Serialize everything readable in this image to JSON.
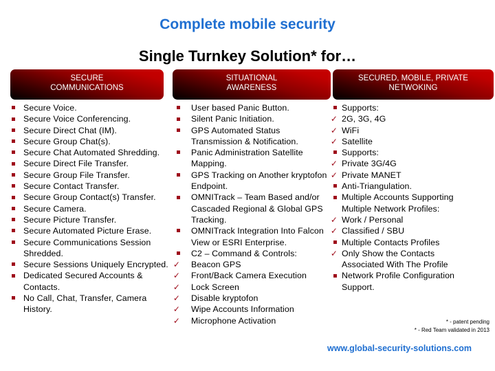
{
  "title": "Complete mobile security",
  "subtitle": "Single Turnkey Solution* for…",
  "colors": {
    "title_blue": "#1f6fd1",
    "header_red": "#c00000",
    "bullet_red": "#9e0b1a"
  },
  "columns": [
    {
      "header": "SECURE\nCOMMUNICATIONS",
      "items": [
        {
          "marker": "square",
          "text": "Secure Voice."
        },
        {
          "marker": "square",
          "text": "Secure Voice Conferencing."
        },
        {
          "marker": "square",
          "text": "Secure Direct Chat (IM)."
        },
        {
          "marker": "square",
          "text": "Secure Group Chat(s)."
        },
        {
          "marker": "square",
          "text": "Secure Chat Automated Shredding."
        },
        {
          "marker": "square",
          "text": "Secure Direct File Transfer."
        },
        {
          "marker": "square",
          "text": "Secure Group File Transfer."
        },
        {
          "marker": "square",
          "text": "Secure Contact Transfer."
        },
        {
          "marker": "square",
          "text": "Secure Group Contact(s) Transfer."
        },
        {
          "marker": "square",
          "text": "Secure Camera."
        },
        {
          "marker": "square",
          "text": "Secure Picture Transfer."
        },
        {
          "marker": "square",
          "text": "Secure Automated Picture Erase."
        },
        {
          "marker": "square",
          "text": "Secure Communications Session Shredded."
        },
        {
          "marker": "square",
          "text": "Secure Sessions Uniquely Encrypted."
        },
        {
          "marker": "square",
          "text": "Dedicated Secured Accounts & Contacts."
        },
        {
          "marker": "square",
          "text": "No Call, Chat, Transfer, Camera History."
        }
      ]
    },
    {
      "header": "SITUATIONAL\nAWARENESS",
      "items": [
        {
          "marker": "square",
          "text": "User based Panic Button."
        },
        {
          "marker": "square",
          "text": "Silent Panic Initiation."
        },
        {
          "marker": "square",
          "text": "GPS Automated Status Transmission & Notification."
        },
        {
          "marker": "square",
          "text": "Panic Administration Satellite Mapping."
        },
        {
          "marker": "square",
          "text": "GPS Tracking on Another kryptofon Endpoint."
        },
        {
          "marker": "square",
          "text": "OMNITrack – Team Based and/or Cascaded Regional & Global GPS Tracking."
        },
        {
          "marker": "square",
          "text": "OMNITrack Integration Into Falcon View or ESRI Enterprise."
        },
        {
          "marker": "square",
          "text": "C2 – Command & Controls:"
        },
        {
          "marker": "check",
          "text": "Beacon GPS"
        },
        {
          "marker": "check",
          "text": "Front/Back Camera Execution"
        },
        {
          "marker": "check",
          "text": "Lock Screen"
        },
        {
          "marker": "check",
          "text": "Disable kryptofon"
        },
        {
          "marker": "check",
          "text": "Wipe Accounts Information"
        },
        {
          "marker": "check",
          "text": "Microphone Activation"
        }
      ]
    },
    {
      "header": "SECURED, MOBILE, PRIVATE\nNETWOKING",
      "items": [
        {
          "marker": "square",
          "text": "Supports:"
        },
        {
          "marker": "check",
          "text": "2G, 3G, 4G"
        },
        {
          "marker": "check",
          "text": "WiFi"
        },
        {
          "marker": "check",
          "text": "Satellite"
        },
        {
          "marker": "square",
          "text": "Supports:"
        },
        {
          "marker": "check",
          "text": "Private 3G/4G"
        },
        {
          "marker": "check",
          "text": "Private MANET"
        },
        {
          "marker": "square",
          "text": "Anti-Triangulation."
        },
        {
          "marker": "square",
          "text": "Multiple Accounts Supporting Multiple Network Profiles:"
        },
        {
          "marker": "check",
          "text": "Work / Personal"
        },
        {
          "marker": "check",
          "text": "Classified / SBU"
        },
        {
          "marker": "square",
          "text": "Multiple Contacts Profiles"
        },
        {
          "marker": "check",
          "text": "Only Show the Contacts Associated With The Profile"
        },
        {
          "marker": "square",
          "text": "Network Profile Configuration Support."
        }
      ]
    }
  ],
  "footnotes": [
    "* - patent pending",
    "* - Red Team validated in 2013"
  ],
  "website": "www.global-security-solutions.com"
}
